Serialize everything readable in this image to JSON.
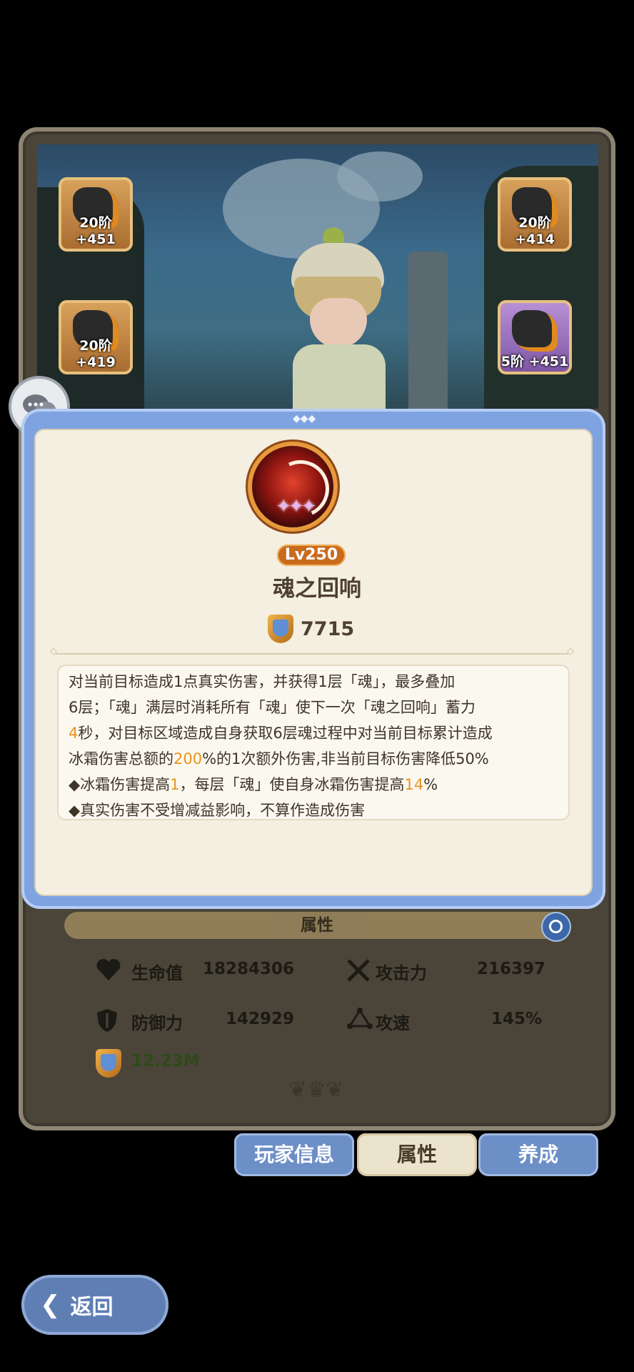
{
  "equipment": [
    {
      "level": "20阶 +451"
    },
    {
      "level": "20阶 +419"
    },
    {
      "level": "20阶 +414"
    },
    {
      "level": "5阶 +451"
    }
  ],
  "skill": {
    "level": "Lv250",
    "name": "魂之回响",
    "power": "7715",
    "desc": [
      [
        "对当前目标造成1点真实伤害，并获得1层「魂」，最多叠加"
      ],
      [
        "6层；「魂」满层时消耗所有「魂」使下一次「魂之回响」蓄力"
      ],
      [
        "4",
        "秒，对目标区域造成自身获取6层魂过程中对当前目标累计造成"
      ],
      [
        "冰霜伤害总额的",
        "200",
        "%的1次额外伤害,非当前目标伤害降低50%"
      ],
      [
        "◆冰霜伤害提高",
        "1",
        "，每层「魂」使自身冰霜伤害提高",
        "14",
        "%"
      ],
      [
        "◆真实伤害不受增减益影响，不算作造成伤害"
      ]
    ]
  },
  "attributes": {
    "header": "属性",
    "hp_label": "生命值",
    "hp_value": "18284306",
    "atk_label": "攻击力",
    "atk_value": "216397",
    "def_label": "防御力",
    "def_value": "142929",
    "spd_label": "攻速",
    "spd_value": "145%",
    "power_value": "12.23M"
  },
  "tabs": {
    "player_info": "玩家信息",
    "attributes": "属性",
    "develop": "养成"
  },
  "back": {
    "label": "返回"
  },
  "colors": {
    "highlight": "#e8941c",
    "tab_blue": "#6d8fc8",
    "level_badge": "#c96b1d"
  }
}
